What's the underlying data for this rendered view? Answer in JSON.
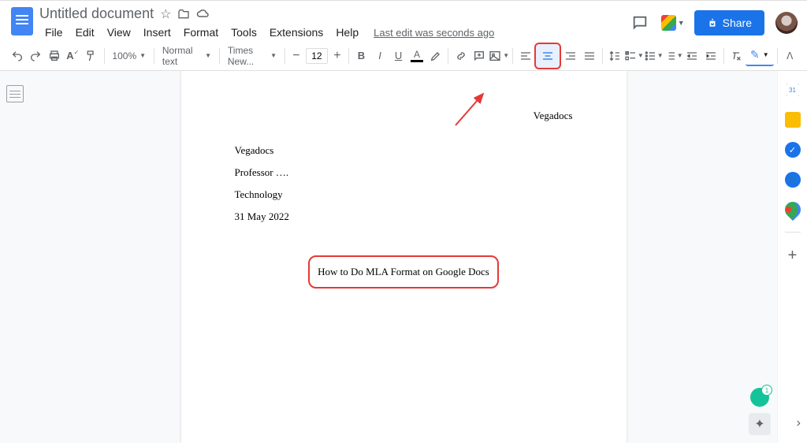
{
  "header": {
    "doc_title": "Untitled document",
    "last_edit": "Last edit was seconds ago",
    "share_label": "Share"
  },
  "menubar": [
    "File",
    "Edit",
    "View",
    "Insert",
    "Format",
    "Tools",
    "Extensions",
    "Help"
  ],
  "toolbar": {
    "zoom": "100%",
    "style": "Normal text",
    "font": "Times New...",
    "font_size": "12"
  },
  "document": {
    "running_header": "Vegadocs",
    "line1": "Vegadocs",
    "line2": "Professor ….",
    "line3": "Technology",
    "line4": "31 May 2022",
    "title": "How to Do MLA Format on Google Docs"
  }
}
